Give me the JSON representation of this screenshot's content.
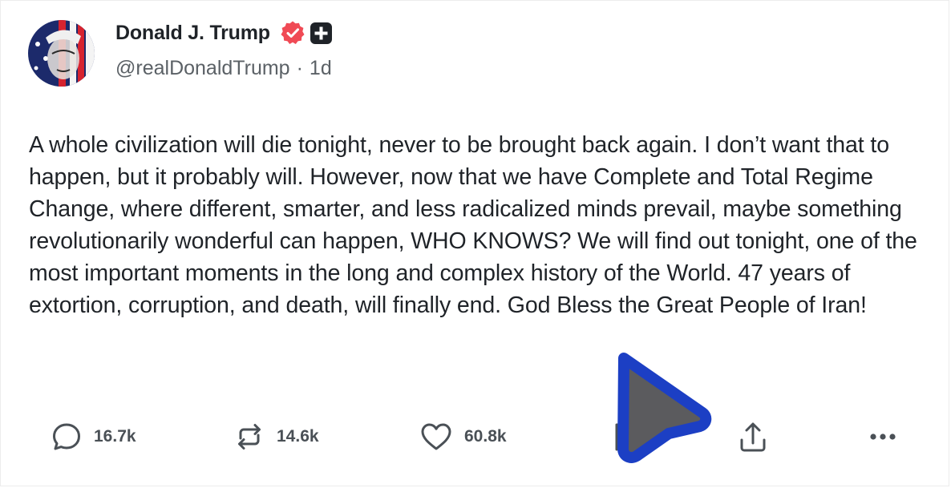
{
  "post": {
    "author_name": "Donald J. Trump",
    "handle": "@realDonaldTrump",
    "separator": "·",
    "time": "1d",
    "text": "A whole civilization will die tonight, never to be brought back again. I don’t want that to happen, but it probably will. However, now that we have Complete and Total Regime Change, where different, smarter, and less radicalized minds prevail, maybe something revolutionarily wonderful can happen, WHO KNOWS? We will find out tonight, one of the most important moments in the long and complex history of the World. 47 years of extortion, corruption, and death, will finally end. God Bless the Great People of Iran!"
  },
  "actions": {
    "replies": "16.7k",
    "reposts": "14.6k",
    "likes": "60.8k"
  },
  "icons": {
    "verified": "verified-badge-icon",
    "plus": "plus-badge-icon",
    "reply": "speech-bubble-icon",
    "repost": "repost-arrows-icon",
    "like": "heart-icon",
    "share": "share-upload-icon",
    "more": "more-dots-icon",
    "cursor": "mouse-pointer-icon"
  },
  "colors": {
    "verified": "#f04a55",
    "cursor_fill": "#5b5b5e",
    "cursor_outline": "#1c3fc4",
    "text": "#1f2328",
    "muted": "#5b6166"
  }
}
